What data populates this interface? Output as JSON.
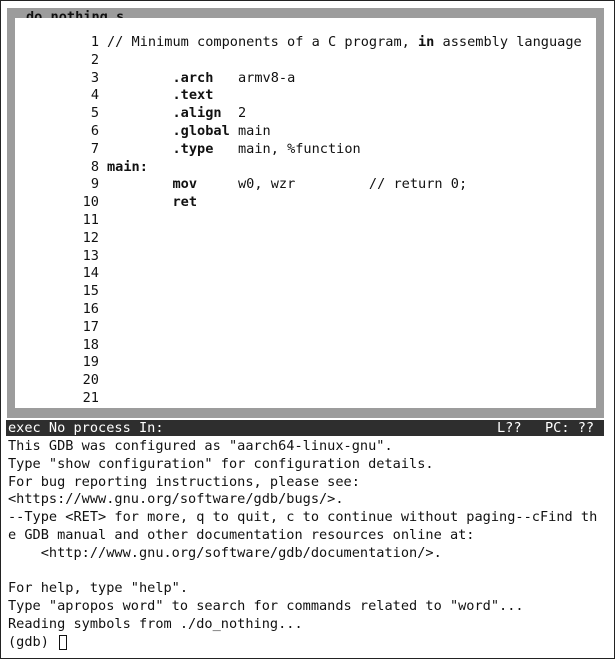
{
  "source_window": {
    "filename": "do_nothing.s",
    "lines": [
      {
        "num": "1",
        "parts": [
          {
            "t": "// Minimum components of a C program, ",
            "b": false
          },
          {
            "t": "in",
            "b": true
          },
          {
            "t": " assembly language",
            "b": false
          }
        ]
      },
      {
        "num": "2",
        "parts": []
      },
      {
        "num": "3",
        "parts": [
          {
            "t": "        ",
            "b": false
          },
          {
            "t": ".arch",
            "b": true
          },
          {
            "t": "   armv8-a",
            "b": false
          }
        ]
      },
      {
        "num": "4",
        "parts": [
          {
            "t": "        ",
            "b": false
          },
          {
            "t": ".text",
            "b": true
          }
        ]
      },
      {
        "num": "5",
        "parts": [
          {
            "t": "        ",
            "b": false
          },
          {
            "t": ".align",
            "b": true
          },
          {
            "t": "  2",
            "b": false
          }
        ]
      },
      {
        "num": "6",
        "parts": [
          {
            "t": "        ",
            "b": false
          },
          {
            "t": ".global",
            "b": true
          },
          {
            "t": " main",
            "b": false
          }
        ]
      },
      {
        "num": "7",
        "parts": [
          {
            "t": "        ",
            "b": false
          },
          {
            "t": ".type",
            "b": true
          },
          {
            "t": "   main, %function",
            "b": false
          }
        ]
      },
      {
        "num": "8",
        "parts": [
          {
            "t": "main:",
            "b": true
          }
        ]
      },
      {
        "num": "9",
        "parts": [
          {
            "t": "        ",
            "b": false
          },
          {
            "t": "mov",
            "b": true
          },
          {
            "t": "     w0, wzr         // return 0;",
            "b": false
          }
        ]
      },
      {
        "num": "10",
        "parts": [
          {
            "t": "        ",
            "b": false
          },
          {
            "t": "ret",
            "b": true
          }
        ]
      },
      {
        "num": "11",
        "parts": []
      },
      {
        "num": "12",
        "parts": []
      },
      {
        "num": "13",
        "parts": []
      },
      {
        "num": "14",
        "parts": []
      },
      {
        "num": "15",
        "parts": []
      },
      {
        "num": "16",
        "parts": []
      },
      {
        "num": "17",
        "parts": []
      },
      {
        "num": "18",
        "parts": []
      },
      {
        "num": "19",
        "parts": []
      },
      {
        "num": "20",
        "parts": []
      },
      {
        "num": "21",
        "parts": []
      }
    ]
  },
  "status_bar": {
    "left": "exec No process In:",
    "line": "L??",
    "pc": "PC: ??"
  },
  "console": {
    "lines": [
      "This GDB was configured as \"aarch64-linux-gnu\".",
      "Type \"show configuration\" for configuration details.",
      "For bug reporting instructions, please see:",
      "<https://www.gnu.org/software/gdb/bugs/>.",
      "--Type <RET> for more, q to quit, c to continue without paging--cFind th",
      "e GDB manual and other documentation resources online at:",
      "    <http://www.gnu.org/software/gdb/documentation/>.",
      "",
      "For help, type \"help\".",
      "Type \"apropos word\" to search for commands related to \"word\"...",
      "Reading symbols from ./do_nothing..."
    ],
    "prompt": "(gdb) ",
    "input_value": ""
  }
}
